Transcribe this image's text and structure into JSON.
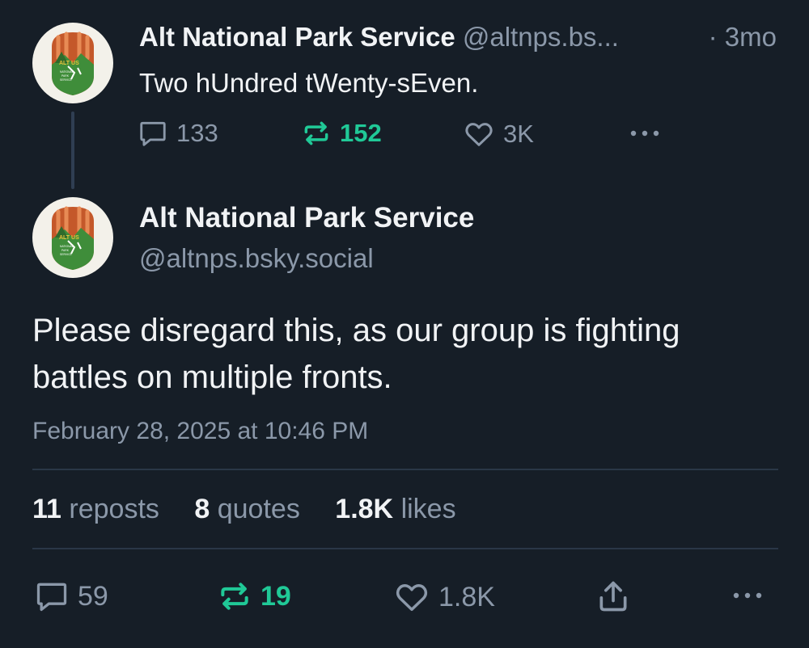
{
  "parent_post": {
    "author_name": "Alt National Park Service",
    "author_handle": "@altnps.bs...",
    "time_separator": "·",
    "time_ago": "3mo",
    "text": "Two hUndred tWenty-sEven.",
    "actions": {
      "replies": "133",
      "reposts": "152",
      "likes": "3K"
    }
  },
  "main_post": {
    "author_name": "Alt National Park Service",
    "author_handle": "@altnps.bsky.social",
    "text": "Please disregard this, as our group is fighting battles on multiple fronts.",
    "timestamp": "February 28, 2025 at 10:46 PM",
    "stats": {
      "reposts_count": "11",
      "reposts_label": "reposts",
      "quotes_count": "8",
      "quotes_label": "quotes",
      "likes_count": "1.8K",
      "likes_label": "likes"
    },
    "actions": {
      "replies": "59",
      "reposts": "19",
      "likes": "1.8K"
    }
  },
  "avatar": {
    "logo_text": "ALT US",
    "logo_subtext": "NATIONAL PARK SERVICE"
  },
  "icons": {
    "reply": "speech-bubble-icon",
    "repost": "repost-arrows-icon",
    "like": "heart-icon",
    "share": "share-upload-icon",
    "more": "ellipsis-icon"
  },
  "colors": {
    "background": "#161e27",
    "text_primary": "#f1f3f5",
    "text_secondary": "#8b98a9",
    "repost_active": "#20c997",
    "divider": "#2a3747"
  }
}
